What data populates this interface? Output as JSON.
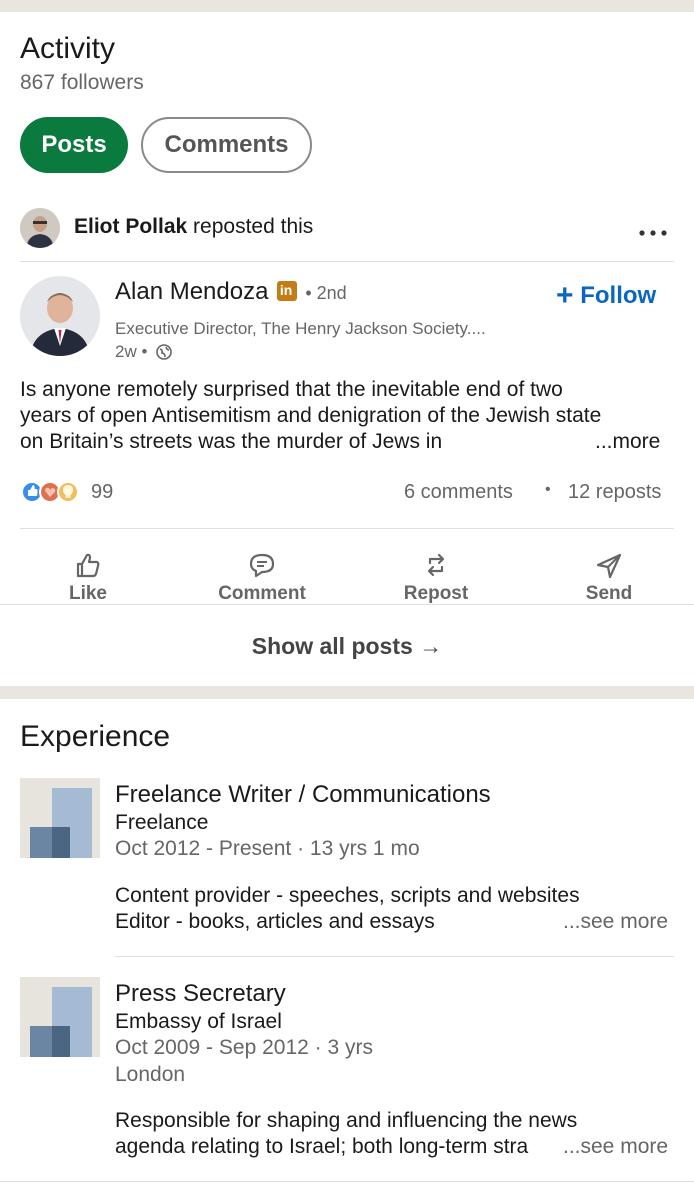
{
  "activity": {
    "title": "Activity",
    "followers": "867 followers",
    "tabs": [
      {
        "label": "Posts",
        "active": true
      },
      {
        "label": "Comments",
        "active": false
      }
    ],
    "repost": {
      "name": "Eliot Pollak",
      "text": "reposted this",
      "more_icon": "ellipsis-icon"
    },
    "post": {
      "author": "Alan Mendoza",
      "degree": "• 2nd",
      "headline": "Executive Director, The Henry Jackson Society....",
      "age": "2w •",
      "follow_label": "Follow",
      "body_lines": [
        "Is anyone remotely surprised that the inevitable end of two",
        "years of open Antisemitism and denigration of the Jewish state",
        "on Britain’s streets was the murder of Jews in"
      ],
      "more_label": "...more",
      "reaction_count": "99",
      "comments": "6 comments",
      "separator": "•",
      "reposts": "12 reposts"
    },
    "actions": [
      {
        "label": "Like",
        "icon": "thumbs-up-icon"
      },
      {
        "label": "Comment",
        "icon": "comment-icon"
      },
      {
        "label": "Repost",
        "icon": "repost-icon"
      },
      {
        "label": "Send",
        "icon": "send-icon"
      }
    ],
    "show_all": "Show all posts →"
  },
  "experience": {
    "title": "Experience",
    "items": [
      {
        "title": "Freelance Writer / Communications",
        "company": "Freelance",
        "dates": "Oct 2012 - Present · 13 yrs 1 mo",
        "location": "",
        "description": [
          "Content provider - speeches, scripts and websites",
          "Editor - books, articles and essays"
        ],
        "see_more": "...see more"
      },
      {
        "title": "Press Secretary",
        "company": "Embassy of Israel",
        "dates": "Oct 2009 - Sep 2012 · 3 yrs",
        "location": "London",
        "description": [
          "Responsible for shaping and influencing the news",
          "agenda relating to Israel; both long-term stra"
        ],
        "see_more": "...see more"
      }
    ]
  },
  "colors": {
    "accent_green": "#0a7a3e",
    "link_blue": "#0a66c2",
    "linkedin_badge": "#c37d16",
    "background": "#e9e6df"
  }
}
